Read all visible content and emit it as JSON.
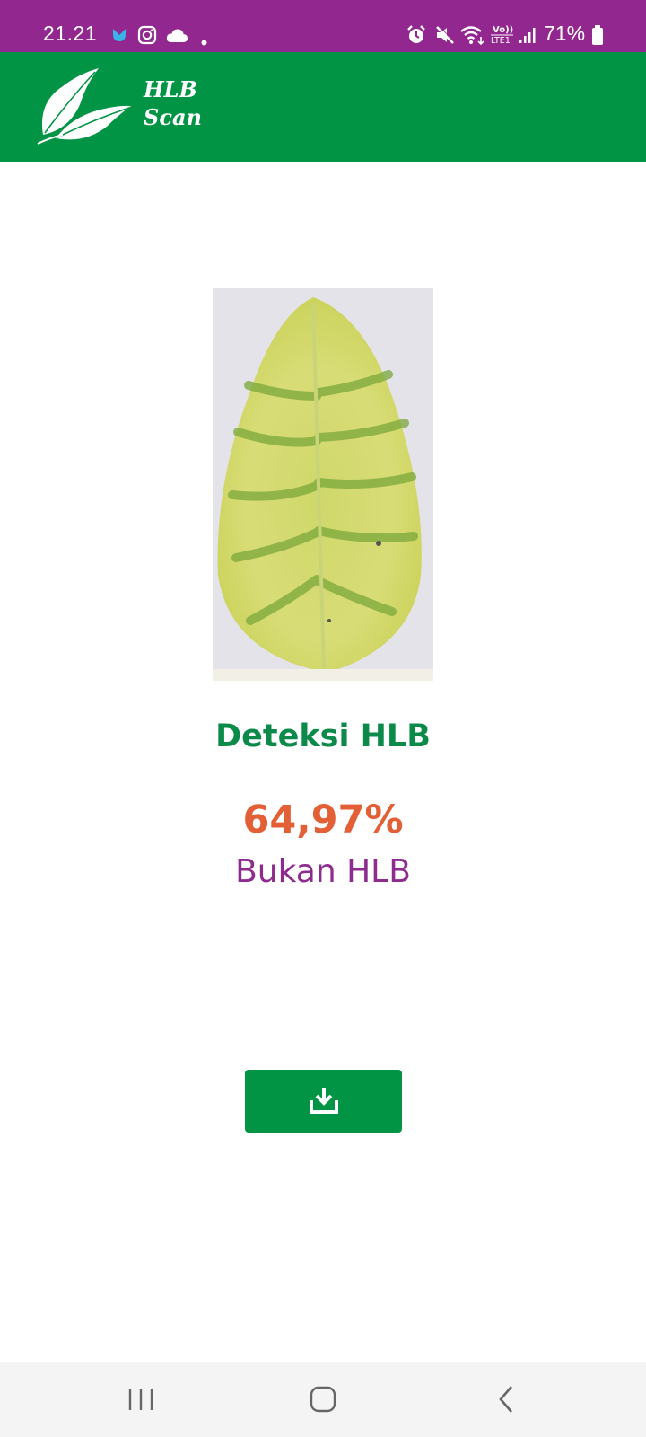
{
  "status_bar": {
    "time": "21.21",
    "battery": "71%",
    "background": "#92278f",
    "left_icons": [
      "app-notification-icon",
      "instagram-icon",
      "cloud-icon",
      "dot-icon"
    ],
    "right_icons": [
      "alarm-icon",
      "mute-icon",
      "wifi-icon",
      "volte-lte-icon",
      "signal-icon",
      "battery-icon"
    ]
  },
  "header": {
    "title_line1": "HLB",
    "title_line2": "Scan",
    "background": "#009444",
    "logo_icon": "leaf-logo-icon"
  },
  "result": {
    "title": "Deteksi HLB",
    "percent": "64,97%",
    "label": "Bukan HLB",
    "title_color": "#0b8a4a",
    "percent_color": "#e35f35",
    "label_color": "#8e2b8e"
  },
  "download_button": {
    "icon": "download-icon",
    "background": "#009444"
  },
  "nav_bar": {
    "icons": [
      "recent-apps-icon",
      "home-icon",
      "back-icon"
    ]
  }
}
